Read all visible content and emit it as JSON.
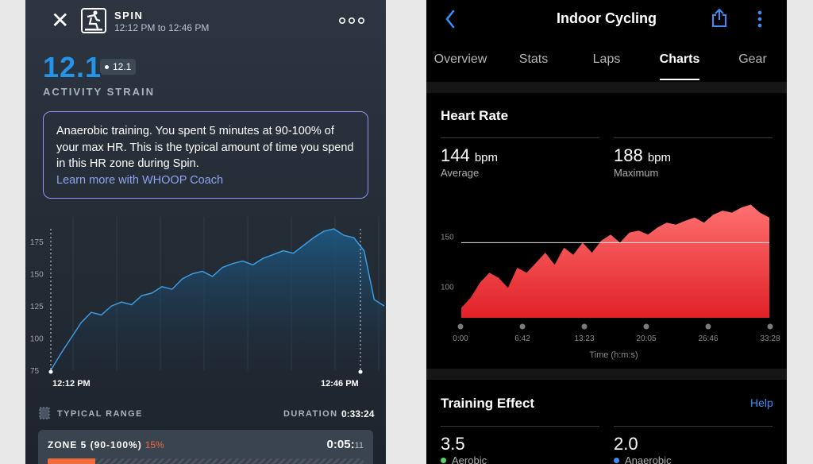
{
  "left_app": {
    "workout_title": "SPIN",
    "time_range": "12:12 PM to 12:46 PM",
    "strain_value": "12.1",
    "strain_badge": "12.1",
    "strain_label": "ACTIVITY STRAIN",
    "coach_message": "Anaerobic training. You spent 5 minutes at 90-100% of your max HR. This is the typical amount of time you spend in this HR zone during Spin.",
    "coach_link": "Learn more with WHOOP Coach",
    "typical_range_label": "TYPICAL RANGE",
    "duration_label": "DURATION",
    "duration_value": "0:33:24",
    "zone": {
      "label": "ZONE 5 (90-100%)",
      "percent": "15%",
      "time_main": "0:05:",
      "time_sub": "11",
      "fill_fraction": 0.15
    },
    "colors": {
      "strain": "#2394e8",
      "coach_border": "#8d96f0",
      "zone5": "#f26b3a",
      "hr_line": "#3d9be0"
    },
    "icons": [
      "close-icon",
      "bike-icon",
      "more-icon",
      "typical-range-icon"
    ],
    "chart_data": {
      "type": "area",
      "y_ticks": [
        "175",
        "150",
        "125",
        "100",
        "75"
      ],
      "ylim": [
        75,
        185
      ],
      "x_labels": [
        "12:12 PM",
        "12:46 PM"
      ],
      "values": [
        75,
        88,
        100,
        112,
        120,
        118,
        125,
        128,
        126,
        133,
        135,
        140,
        138,
        146,
        150,
        152,
        148,
        155,
        158,
        160,
        157,
        162,
        165,
        168,
        166,
        172,
        178,
        183,
        185,
        180,
        178,
        168,
        130,
        125
      ]
    }
  },
  "right_app": {
    "title": "Indoor Cycling",
    "tabs": [
      "Overview",
      "Stats",
      "Laps",
      "Charts",
      "Gear"
    ],
    "active_tab": "Charts",
    "hr_section_title": "Heart Rate",
    "avg_value": "144",
    "avg_unit": "bpm",
    "avg_label": "Average",
    "max_value": "188",
    "max_unit": "bpm",
    "max_label": "Maximum",
    "te_section_title": "Training Effect",
    "help_label": "Help",
    "aerobic_value": "3.5",
    "aerobic_label": "Aerobic",
    "anaerobic_value": "2.0",
    "anaerobic_label": "Anaerobic",
    "colors": {
      "accent": "#3d8df5",
      "hr_fill": "#e8333a",
      "aerobic": "#4cd964",
      "anaerobic": "#3d8df5"
    },
    "icons": [
      "back-chevron-icon",
      "share-icon",
      "kebab-menu-icon"
    ],
    "chart_data": {
      "type": "area",
      "y_ticks": [
        "150",
        "100"
      ],
      "ylim": [
        75,
        190
      ],
      "reference_line": 150,
      "x_ticks": [
        "0:00",
        "6:42",
        "13:23",
        "20:05",
        "26:46",
        "33:28"
      ],
      "xlabel": "Time (h:m:s)",
      "values": [
        85,
        95,
        110,
        120,
        115,
        105,
        125,
        120,
        130,
        140,
        128,
        145,
        138,
        150,
        140,
        152,
        158,
        150,
        160,
        162,
        158,
        165,
        170,
        168,
        172,
        175,
        170,
        178,
        182,
        180,
        185,
        188,
        180,
        175
      ]
    }
  }
}
